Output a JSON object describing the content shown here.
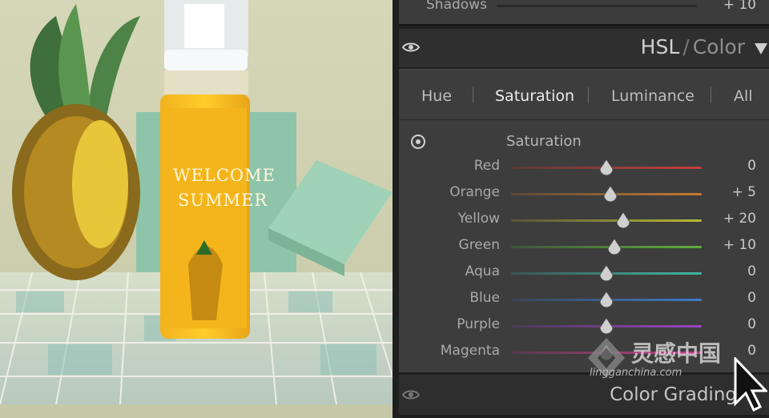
{
  "photo": {
    "bottle_label_line1": "WELCOME",
    "bottle_label_line2": "SUMMER"
  },
  "panel": {
    "shadows": {
      "label": "Shadows",
      "value": "+ 10",
      "level": 0.59
    },
    "hsl": {
      "title_hsl": "HSL",
      "title_slash": "/",
      "title_color": "Color",
      "collapse_icon": "triangle-down-icon",
      "visibility_icon": "eye-icon",
      "tabs": [
        "Hue",
        "Saturation",
        "Luminance",
        "All"
      ],
      "active_tab": "Saturation",
      "target_icon": "target-adjustment-icon",
      "section_label": "Saturation",
      "sliders": [
        {
          "label": "Red",
          "value": "0",
          "level": 0.5,
          "color_from": "#5a3a3a",
          "color_to": "#c2403a"
        },
        {
          "label": "Orange",
          "value": "+ 5",
          "level": 0.52,
          "color_from": "#5a4a3a",
          "color_to": "#c57a2e"
        },
        {
          "label": "Yellow",
          "value": "+ 20",
          "level": 0.59,
          "color_from": "#55553a",
          "color_to": "#b8b835"
        },
        {
          "label": "Green",
          "value": "+ 10",
          "level": 0.54,
          "color_from": "#3e553a",
          "color_to": "#5fae3e"
        },
        {
          "label": "Aqua",
          "value": "0",
          "level": 0.5,
          "color_from": "#3a5553",
          "color_to": "#3fb7a2"
        },
        {
          "label": "Blue",
          "value": "0",
          "level": 0.5,
          "color_from": "#3a4555",
          "color_to": "#3d7bc8"
        },
        {
          "label": "Purple",
          "value": "0",
          "level": 0.5,
          "color_from": "#4a3a55",
          "color_to": "#9a44c2"
        },
        {
          "label": "Magenta",
          "value": "0",
          "level": 0.5,
          "color_from": "#553a4a",
          "color_to": "#c23f8c"
        }
      ]
    },
    "color_grading": {
      "label": "Color Grading"
    }
  },
  "watermark": {
    "brand": "灵感中国",
    "url": "lingganchina.com"
  }
}
